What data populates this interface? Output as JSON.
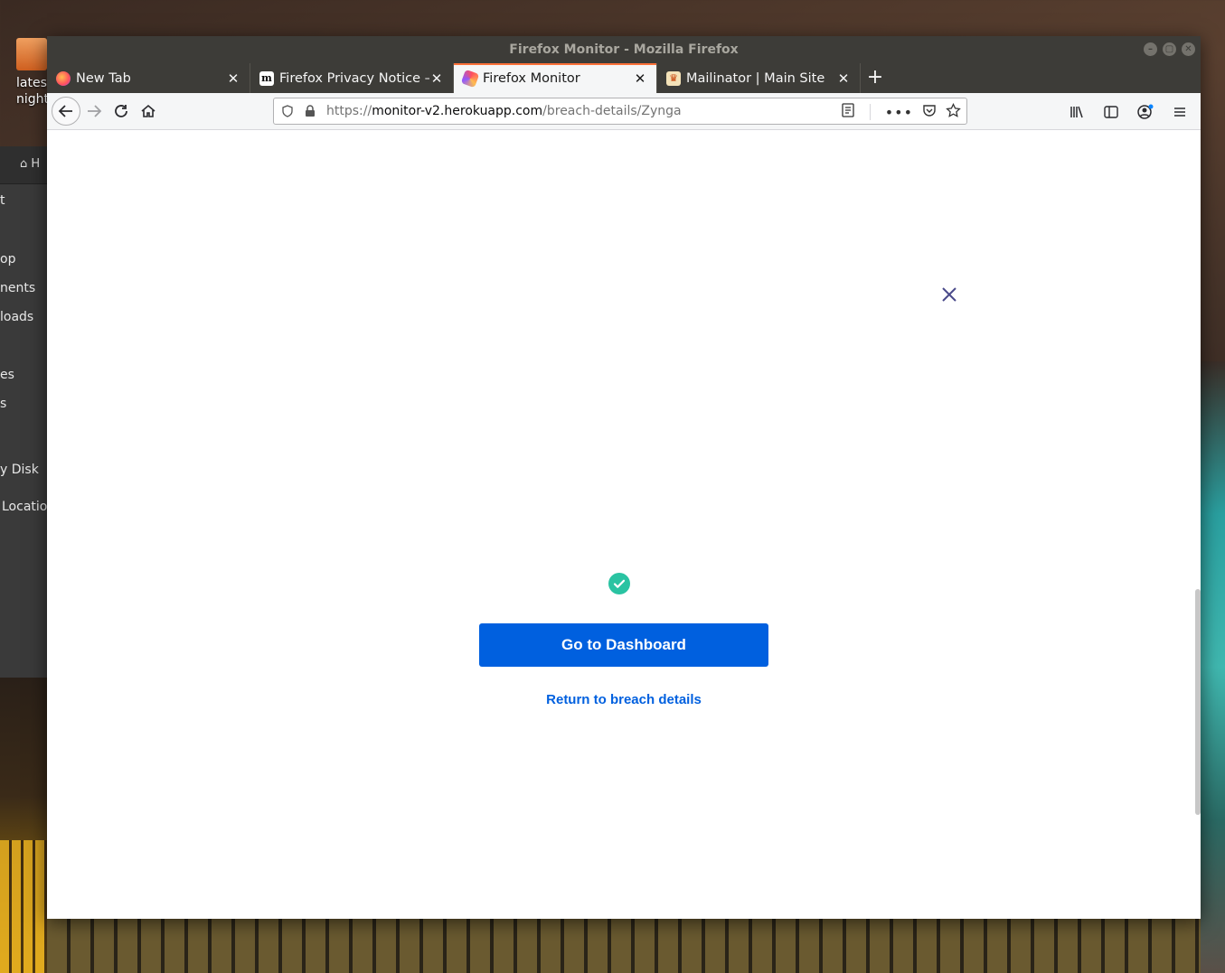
{
  "desktop": {
    "icon_label_1": "lates",
    "icon_label_2": "night",
    "files_sidebar": {
      "header_text": "H",
      "items": [
        "t",
        "op",
        "nents",
        "loads",
        "es",
        "s",
        "y Disk",
        "Locatio"
      ]
    }
  },
  "window": {
    "title": "Firefox Monitor - Mozilla Firefox"
  },
  "tabs": [
    {
      "title": "New Tab",
      "favicon": "firefox-icon",
      "active": false
    },
    {
      "title": "Firefox Privacy Notice —",
      "favicon": "m-icon",
      "active": false
    },
    {
      "title": "Firefox Monitor",
      "favicon": "monitor-icon",
      "active": true
    },
    {
      "title": "Mailinator | Main Site",
      "favicon": "mailinator-icon",
      "active": false
    }
  ],
  "urlbar": {
    "scheme": "https://",
    "host": "monitor-v2.herokuapp.com",
    "path": "/breach-details/Zynga"
  },
  "page": {
    "primary_button": "Go to Dashboard",
    "secondary_link": "Return to breach details",
    "accent_color": "#0060df",
    "success_color": "#2ac3a2"
  }
}
